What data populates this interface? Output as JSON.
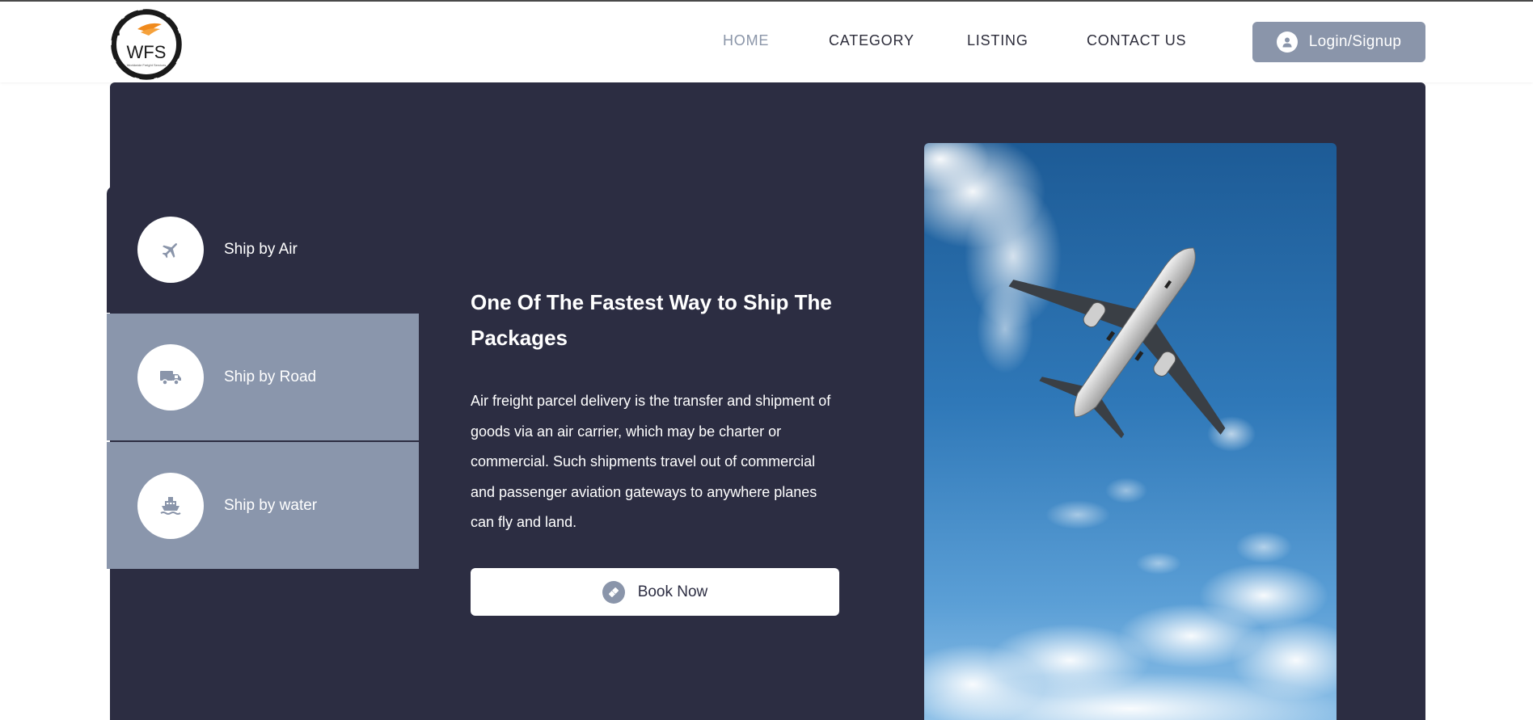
{
  "brand": {
    "logo_text": "WFS",
    "logo_subtext": "Worldwide Freight Services"
  },
  "nav": {
    "items": [
      "HOME",
      "CATEGORY",
      "LISTING",
      "CONTACT US"
    ],
    "active": "HOME",
    "login_label": "Login/Signup"
  },
  "services": {
    "tabs": [
      {
        "label": "Ship by Air",
        "icon": "airplane-icon",
        "active": true
      },
      {
        "label": "Ship by Road",
        "icon": "truck-icon",
        "active": false
      },
      {
        "label": "Ship by water",
        "icon": "ship-icon",
        "active": false
      }
    ]
  },
  "content": {
    "headline": "One Of The Fastest Way to Ship The Packages",
    "description": "Air freight parcel delivery is the transfer and shipment of goods via an air carrier, which may be charter or commercial. Such shipments travel out of commercial and passenger aviation gateways to anywhere planes can fly and land.",
    "book_label": "Book Now"
  },
  "colors": {
    "hero_bg": "#2c2d42",
    "accent": "#8a95aa",
    "nav_active": "#8a95a8",
    "inactive_tab": "#8a96ac"
  }
}
